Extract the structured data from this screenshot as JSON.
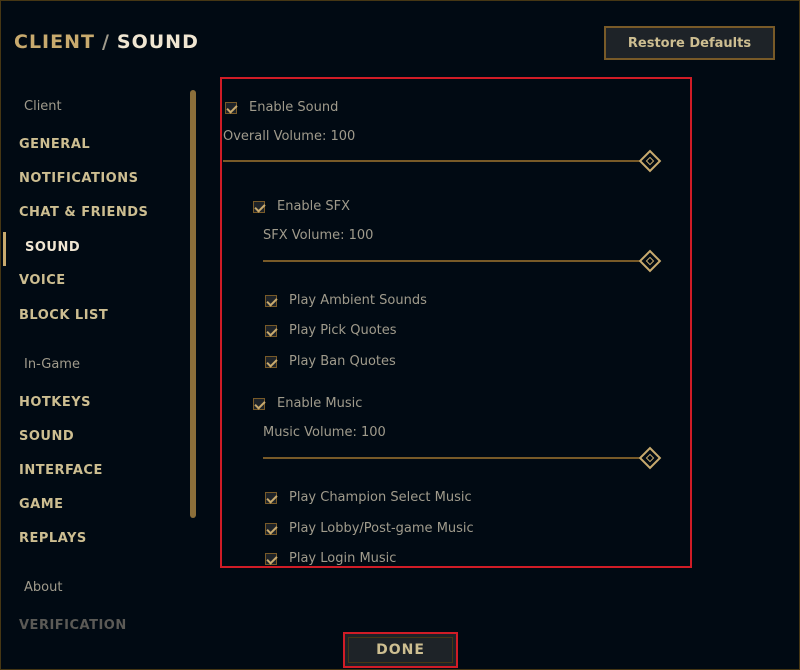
{
  "header": {
    "section": "CLIENT",
    "separator": "/",
    "current": "SOUND",
    "restore_label": "Restore Defaults"
  },
  "sidebar": {
    "groups": [
      {
        "label": "Client"
      },
      {
        "label": "In-Game"
      },
      {
        "label": "About"
      }
    ],
    "items": [
      {
        "label": "GENERAL"
      },
      {
        "label": "NOTIFICATIONS"
      },
      {
        "label": "CHAT & FRIENDS"
      },
      {
        "label": "SOUND"
      },
      {
        "label": "VOICE"
      },
      {
        "label": "BLOCK LIST"
      },
      {
        "label": "HOTKEYS"
      },
      {
        "label": "SOUND"
      },
      {
        "label": "INTERFACE"
      },
      {
        "label": "GAME"
      },
      {
        "label": "REPLAYS"
      },
      {
        "label": "VERIFICATION"
      }
    ],
    "active_item": "SOUND"
  },
  "sound": {
    "enable_sound": "Enable Sound",
    "overall_volume": "Overall Volume: 100",
    "overall_level": 1.0,
    "enable_sfx": "Enable SFX",
    "sfx_volume": "SFX Volume: 100",
    "sfx_level": 1.0,
    "ambient": "Play Ambient Sounds",
    "pick_quotes": "Play Pick Quotes",
    "ban_quotes": "Play Ban Quotes",
    "enable_music": "Enable Music",
    "music_volume": "Music Volume: 100",
    "music_level": 1.0,
    "champ_select_music": "Play Champion Select Music",
    "lobby_music": "Play Lobby/Post-game Music",
    "login_music": "Play Login Music"
  },
  "footer": {
    "done_label": "DONE"
  },
  "colors": {
    "background": "#010a13",
    "gold": "#c8aa6e",
    "highlight_red": "#d01c26"
  }
}
